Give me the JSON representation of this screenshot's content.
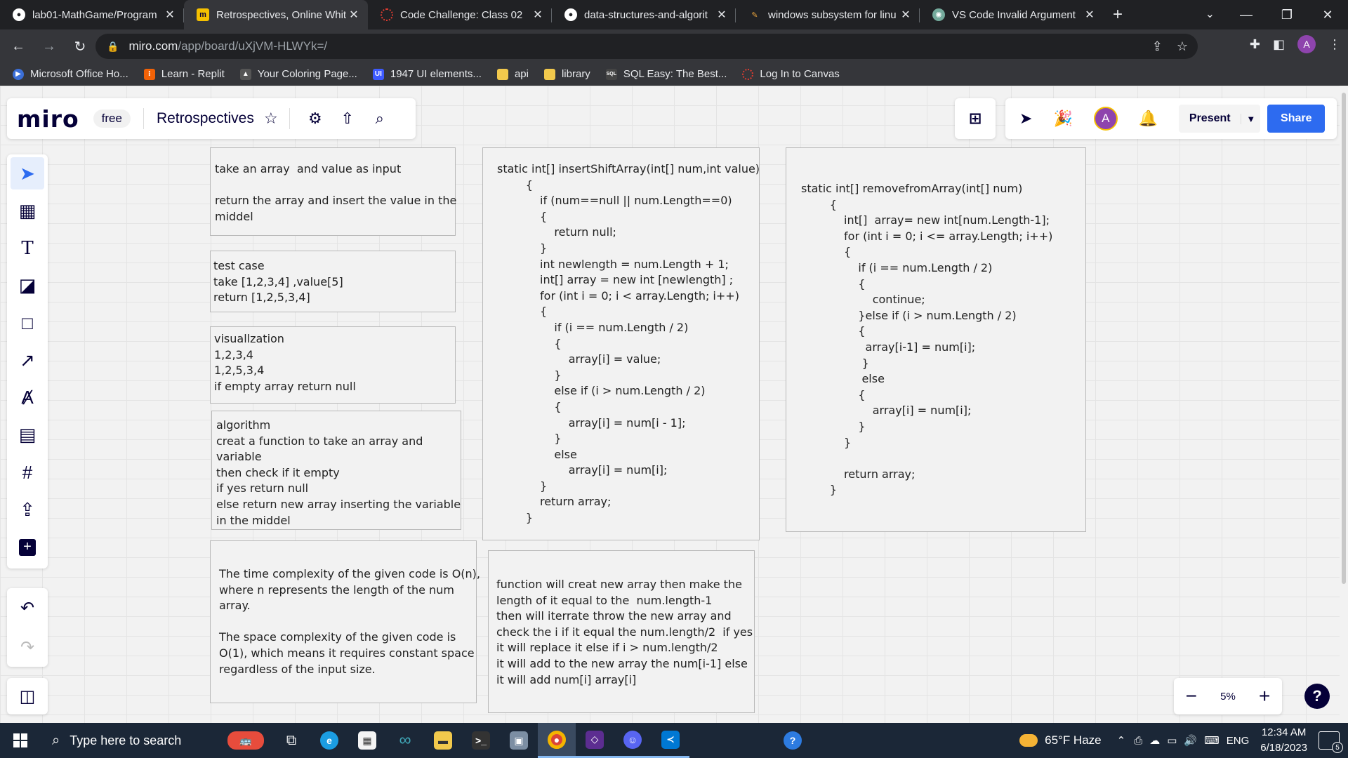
{
  "tabs": [
    {
      "title": "lab01-MathGame/Program",
      "favicon": "github-icon",
      "color": "#ffffff"
    },
    {
      "title": "Retrospectives, Online Whit",
      "favicon": "miro-icon",
      "color": "#f5c000"
    },
    {
      "title": "Code Challenge: Class 02",
      "favicon": "canvas-icon",
      "color": "#e03c31"
    },
    {
      "title": "data-structures-and-algorit",
      "favicon": "github-icon",
      "color": "#ffffff"
    },
    {
      "title": "windows subsystem for linu",
      "favicon": "search-icon",
      "color": "#e8a33d"
    },
    {
      "title": "VS Code Invalid Argument",
      "favicon": "chatgpt-icon",
      "color": "#74aa9c"
    }
  ],
  "address": {
    "host": "miro.com",
    "path": "/app/board/uXjVM-HLWYk=/"
  },
  "profile_initial": "A",
  "bookmarks": [
    {
      "label": "Microsoft Office Ho...",
      "color": "#3b6fd8"
    },
    {
      "label": "Learn - Replit",
      "color": "#f26207"
    },
    {
      "label": "Your Coloring Page...",
      "color": "#555555"
    },
    {
      "label": "1947 UI elements...",
      "color": "#3d5afe"
    },
    {
      "label": "api",
      "color": "#f2c94c"
    },
    {
      "label": "library",
      "color": "#f2c94c"
    },
    {
      "label": "SQL Easy: The Best...",
      "color": "#444444"
    },
    {
      "label": "Log In to Canvas",
      "color": "#e03c31"
    }
  ],
  "miro": {
    "logo": "miro",
    "plan": "free",
    "board_title": "Retrospectives",
    "avatar_initial": "A",
    "present_label": "Present",
    "share_label": "Share",
    "zoom": "5%"
  },
  "notes": {
    "input": "take an array  and value as input\n\nreturn the array and insert the value in the\nmiddel",
    "testcase": "test case\ntake [1,2,3,4] ,value[5]\nreturn [1,2,5,3,4]",
    "visual": "visuallzation\n1,2,3,4\n1,2,5,3,4\nif empty array return null",
    "algorithm": "algorithm\ncreat a function to take an array and\nvariable\nthen check if it empty\nif yes return null\nelse return new array inserting the variable\nin the middel",
    "complexity": "The time complexity of the given code is O(n),\nwhere n represents the length of the num\narray.\n\nThe space complexity of the given code is\nO(1), which means it requires constant space\nregardless of the input size.",
    "insert_code": "static int[] insertShiftArray(int[] num,int value)\n        {\n            if (num==null || num.Length==0)\n            {\n                return null;\n            }\n            int newlength = num.Length + 1;\n            int[] array = new int [newlength] ;\n            for (int i = 0; i < array.Length; i++)\n            {\n                if (i == num.Length / 2)\n                {\n                    array[i] = value;\n                }\n                else if (i > num.Length / 2)\n                {\n                    array[i] = num[i - 1];\n                }\n                else\n                    array[i] = num[i];\n            }\n            return array;\n        }",
    "remove_desc": "function will creat new array then make the\nlength of it equal to the  num.length-1\nthen will iterrate throw the new array and\ncheck the i if it equal the num.length/2  if yes\nit will replace it else if i > num.length/2\nit will add to the new array the num[i-1] else\nit will add num[i] array[i]",
    "remove_code": "static int[] removefromArray(int[] num)\n        {\n            int[]  array= new int[num.Length-1];\n            for (int i = 0; i <= array.Length; i++)\n            {\n                if (i == num.Length / 2)\n                {\n                    continue;\n                }else if (i > num.Length / 2)\n                {\n                  array[i-1] = num[i];\n                 }\n                 else\n                {\n                    array[i] = num[i];\n                }\n            }\n\n            return array;\n        }"
  },
  "taskbar": {
    "search_placeholder": "Type here to search",
    "weather": "65°F  Haze",
    "language": "ENG",
    "time": "12:34 AM",
    "date": "6/18/2023",
    "notifications": "5"
  }
}
